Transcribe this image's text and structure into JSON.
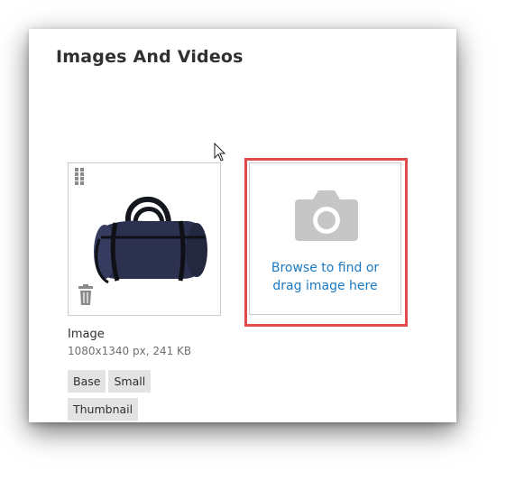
{
  "section": {
    "title": "Images And Videos"
  },
  "image_card": {
    "label": "Image",
    "meta": "1080x1340 px, 241 KB",
    "roles": [
      "Base",
      "Small",
      "Thumbnail"
    ]
  },
  "upload": {
    "line1": "Browse to find or",
    "line2": "drag image here"
  },
  "colors": {
    "highlight": "#e24b4b",
    "link": "#1979c3",
    "icon_gray": "#c6c6c6"
  },
  "icons": [
    "drag-handle-icon",
    "trash-icon",
    "camera-icon",
    "cursor-icon"
  ]
}
